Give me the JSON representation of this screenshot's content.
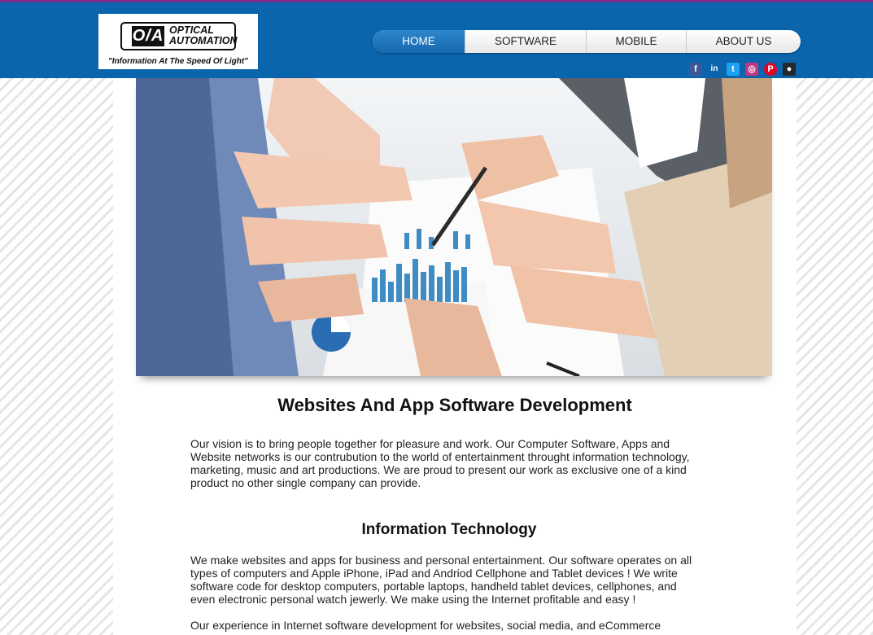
{
  "header": {
    "logo_mark": "O/A",
    "logo_line1": "OPTICAL",
    "logo_line2": "AUTOMATION",
    "tagline": "\"Information At The Speed Of Light\""
  },
  "nav": {
    "items": [
      "HOME",
      "SOFTWARE",
      "MOBILE",
      "ABOUT US"
    ],
    "active": "HOME"
  },
  "social": [
    {
      "icon": "facebook-icon",
      "glyph": "f",
      "color": "#3b5998"
    },
    {
      "icon": "linkedin-icon",
      "glyph": "in",
      "color": "#0a65ad"
    },
    {
      "icon": "twitter-icon",
      "glyph": "t",
      "color": "#1da1f2"
    },
    {
      "icon": "instagram-icon",
      "glyph": "◎",
      "color": "#c13584"
    },
    {
      "icon": "pinterest-icon",
      "glyph": "P",
      "color": "#e60023"
    },
    {
      "icon": "github-icon",
      "glyph": "●",
      "color": "#24292e"
    }
  ],
  "main": {
    "title": "Websites And App Software Development",
    "intro": "Our vision is to bring people together for pleasure and work. Our Computer Software, Apps and Website networks is our contrubution to the world of entertainment throught information technology, marketing, music and art productions. We are proud to present our work as exclusive one of a kind product no other single company can provide.",
    "section_title": "Information Technology",
    "section_text": "We make websites and apps for business and personal entertainment. Our software operates on all types of computers and Apple iPhone, iPad and Andriod Cellphone and Tablet devices ! We write software code for desktop computers, portable laptops, handheld tablet devices, cellphones, and even electronic personal watch jewerly. We make using the Internet profitable and easy !",
    "section_text_2": "Our experience in Internet software development for websites, social media, and eCommerce"
  },
  "colors": {
    "header_bg": "#0a65ad",
    "accent_line": "#7a2d8c",
    "nav_active": "#1f78bf"
  }
}
